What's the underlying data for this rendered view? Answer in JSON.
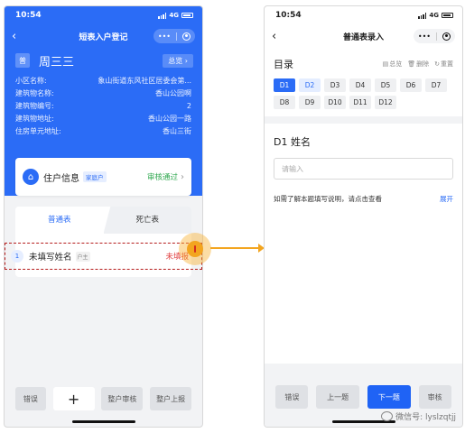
{
  "status_time": "10:54",
  "status_network": "4G",
  "left": {
    "nav_title": "短表入户登记",
    "resident_tag": "普",
    "resident_name": "周三三",
    "overview_label": "总览",
    "info": [
      {
        "label": "小区名称:",
        "value": "象山街道东风社区居委会第..."
      },
      {
        "label": "建筑物名称:",
        "value": "香山公园啊"
      },
      {
        "label": "建筑物编号:",
        "value": "2"
      },
      {
        "label": "建筑物地址:",
        "value": "香山公园一路"
      },
      {
        "label": "住房单元地址:",
        "value": "香山三街"
      }
    ],
    "household": {
      "title": "住户信息",
      "badge": "家庭户",
      "status": "审核通过",
      "status_color": "#2fa84f"
    },
    "tabs": [
      {
        "label": "普通表"
      },
      {
        "label": "死亡表"
      }
    ],
    "record": {
      "index": "1",
      "name": "未填写姓名",
      "tag": "户主",
      "status": "未填报",
      "status_color": "#e03c3c"
    },
    "buttons": {
      "error": "错误",
      "add": "+",
      "household_audit": "整户审核",
      "household_report": "整户上报"
    }
  },
  "right": {
    "nav_title": "普通表录入",
    "catalog_title": "目录",
    "actions": {
      "overview": "总览",
      "delete": "删除",
      "reset": "重置"
    },
    "questions": [
      "D1",
      "D2",
      "D3",
      "D4",
      "D5",
      "D6",
      "D7",
      "D8",
      "D9",
      "D10",
      "D11",
      "D12"
    ],
    "current_question": "D1",
    "question_title": "D1 姓名",
    "input_placeholder": "请输入",
    "help_text": "如需了解本题填写说明，请点击查看",
    "help_expand": "展开",
    "buttons": {
      "error": "错误",
      "prev": "上一题",
      "next": "下一题",
      "audit": "审核"
    }
  },
  "watermark": "微信号: lyslzqtjj",
  "colors": {
    "primary": "#2b6cf6",
    "highlight": "#f3a51f",
    "dashed_border": "#b61c1c"
  }
}
